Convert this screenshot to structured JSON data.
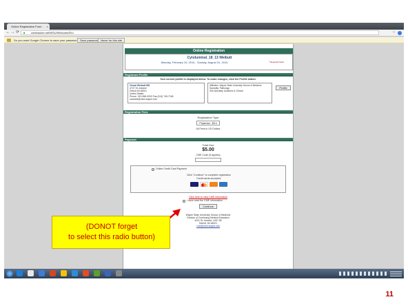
{
  "browser": {
    "tab_title": "Online Registration Form",
    "tab_close": "×",
    "back_glyph": "←",
    "forward_glyph": "→",
    "reload_glyph": "⟳",
    "url": "cmetracker.net/WSU/Welcome/Ero",
    "star_glyph": "☆",
    "password_prompt": "Do you want Google Chrome to save your password?",
    "save_password": "Save password",
    "never_for_site": "Never for this site"
  },
  "form": {
    "header": "Online Registration",
    "event_title": "Cytoluminal_18_13 Weibutt",
    "event_dates": "Monday, February 10, 2014 - Sunday, August 31, 2014",
    "required_note": "* Required Field",
    "registrant": {
      "section": "Registrant Profile",
      "notice": "Your current profile is displayed below. To make changes, click the Profile button.",
      "left_lines": [
        "Visual Weibutt MD",
        "4747 St. Antoine",
        "Detroit MI 48201",
        "United States",
        "Phone: 313-966-0000 Fax:(313) 745-7165",
        "cwwbutt@med.wayne.edu"
      ],
      "right_lines": [
        "Affiliation: Wayne State University School of Medicine",
        "Specialty: Pathology",
        "Sub Specialty: Anatomic & Clinical"
      ],
      "profile_button": "Profile"
    },
    "fees": {
      "section": "Registration Fees",
      "type_label": "Registration Type",
      "type_value": "Physician - $5 ▾",
      "note": "All Fees in US Dollars"
    },
    "payment": {
      "section": "Payment",
      "total_label": "Total Due",
      "total_value": "$5.00",
      "cme_code": "CME Code (if applies)",
      "method": "Online Credit Card Payment",
      "continue_note": "Click \"Continue\" to complete registration",
      "cards_note": "Credit cards accepted:",
      "read_link": "Click here to view CME information",
      "confirm": "I have read the CME information",
      "continue_button": "Continue",
      "footer": [
        "Wayne State University School of Medicine",
        "Division of Continuing Medical Education",
        "4201 St. Antoine, UHC 9B",
        "Detroit, MI 48201"
      ],
      "footer_email": "cme@med.wayne.edu"
    }
  },
  "annotation": {
    "line1": "(DONOT forget",
    "line2": "to select this radio button)"
  },
  "taskbar": {
    "icon_colors": [
      "#1e7fd6",
      "#e8e8e8",
      "#3c7dd9",
      "#d24726",
      "#f4c20d",
      "#2a8fd8",
      "#e34d26",
      "#5aa02c",
      "#3a66b8",
      "#888888"
    ]
  },
  "slide_number": "11"
}
